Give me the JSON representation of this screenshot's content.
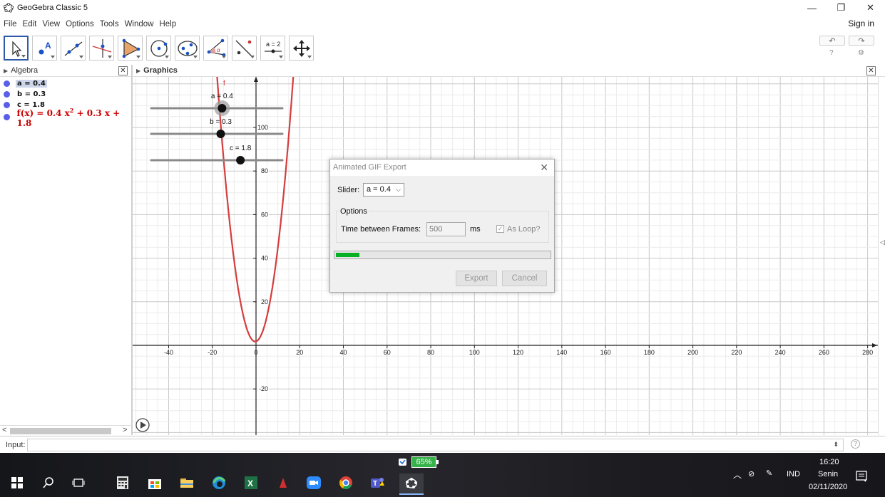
{
  "window": {
    "title": "GeoGebra Classic 5",
    "controls": [
      "—",
      "❐",
      "✕"
    ]
  },
  "menu": {
    "items": [
      "File",
      "Edit",
      "View",
      "Options",
      "Tools",
      "Window",
      "Help"
    ],
    "signin": "Sign in"
  },
  "toolbar": {
    "tools": [
      "move",
      "point",
      "line",
      "perpendicular-line",
      "polygon",
      "circle",
      "conic",
      "angle",
      "reflect",
      "slider",
      "move-graphics-view"
    ],
    "slider_tool_label": "a = 2",
    "point_tool_label": "A",
    "undo": "↶",
    "redo": "↷",
    "help": "?",
    "settings": "⚙"
  },
  "algebra": {
    "title": "Algebra",
    "items": [
      {
        "text": "a = 0.4",
        "selected": true
      },
      {
        "text": "b = 0.3",
        "selected": false
      },
      {
        "text": "c = 1.8",
        "selected": false
      }
    ],
    "function_prefix": "f(x) = 0.4 x",
    "function_exp": "2",
    "function_suffix": " + 0.3 x + 1.8"
  },
  "graphics": {
    "title": "Graphics",
    "function_label": "f",
    "sliders": [
      {
        "label": "a = 0.4",
        "value": 0.4,
        "min": -5,
        "max": 5
      },
      {
        "label": "b = 0.3",
        "value": 0.3,
        "min": -5,
        "max": 5
      },
      {
        "label": "c = 1.8",
        "value": 1.8,
        "min": -5,
        "max": 5
      }
    ],
    "x_ticks": [
      "-40",
      "-20",
      "0",
      "20",
      "40",
      "60",
      "80",
      "100",
      "120",
      "140",
      "160",
      "180",
      "200",
      "220",
      "240",
      "260",
      "280"
    ],
    "y_ticks": [
      "100",
      "80",
      "60",
      "40",
      "20",
      "-20"
    ],
    "curve_color": "#d43d3d",
    "play_icon": "play-icon"
  },
  "dialog": {
    "title": "Animated GIF Export",
    "slider_label": "Slider:",
    "slider_value": "a = 0.4",
    "options_title": "Options",
    "time_label": "Time between Frames:",
    "time_value": "500",
    "ms": "ms",
    "loop_label": "As Loop?",
    "loop_checked": true,
    "progress": 0.11,
    "export": "Export",
    "cancel": "Cancel"
  },
  "input": {
    "label": "Input:",
    "help": "?"
  },
  "taskbar": {
    "battery": "65%",
    "language": "IND",
    "time": "16:20",
    "day": "Senin",
    "date": "02/11/2020"
  }
}
